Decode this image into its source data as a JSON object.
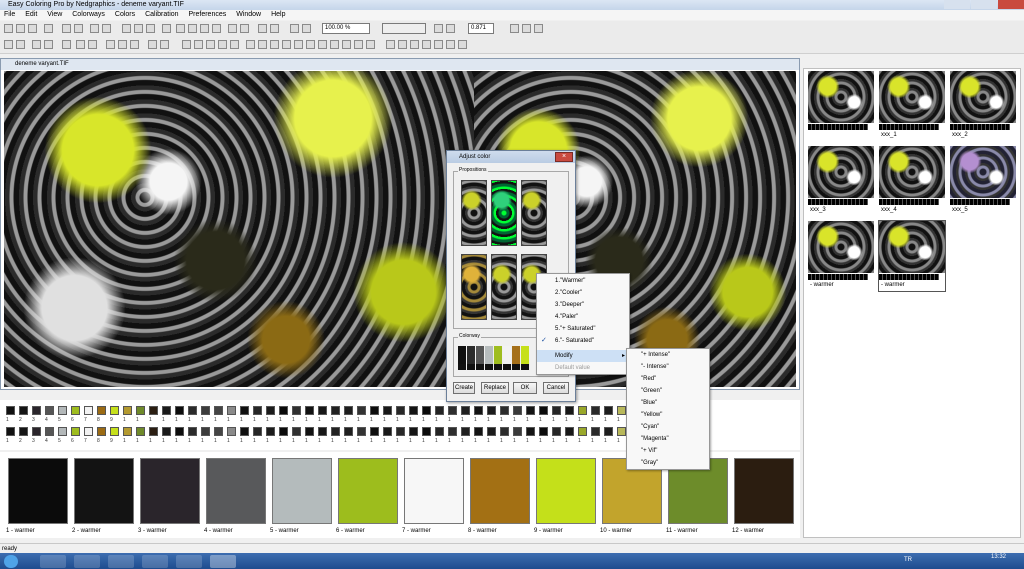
{
  "window": {
    "title": "Easy Coloring Pro by Nedgraphics - deneme varyant.TIF"
  },
  "menu": [
    "File",
    "Edit",
    "View",
    "Colorways",
    "Colors",
    "Calibration",
    "Preferences",
    "Window",
    "Help"
  ],
  "toolbar": {
    "zoom": "100.00 %",
    "value_field": "0.871"
  },
  "document": {
    "title": "deneme varyant.TIF"
  },
  "thumbnails": [
    {
      "label": ""
    },
    {
      "label": "xxx_1"
    },
    {
      "label": "xxx_2"
    },
    {
      "label": "xxx_3"
    },
    {
      "label": "xxx_4"
    },
    {
      "label": "xxx_5"
    },
    {
      "label": "- warmer"
    },
    {
      "label": "- warmer"
    }
  ],
  "swatch_strip": {
    "colors": [
      "#111111",
      "#151515",
      "#2a252b",
      "#555555",
      "#b3b8b9",
      "#9fbd1f",
      "#f2f2f2",
      "#9b6b14",
      "#c6e01c",
      "#b49a30",
      "#6f8a2a",
      "#2b1e12",
      "#1a1a1a",
      "#0d0d0d",
      "#2b2b2b",
      "#3c3c3c",
      "#444444",
      "#8a8a8a",
      "#101010",
      "#262626",
      "#1c1c1c",
      "#0a0a0a",
      "#303030",
      "#121212",
      "#171717",
      "#222222",
      "#1e1e1e",
      "#333333",
      "#0e0e0e",
      "#191919",
      "#282828",
      "#151515",
      "#0b0b0b",
      "#242424",
      "#2e2e2e",
      "#202020",
      "#131313",
      "#1b1b1b",
      "#2c2c2c",
      "#3a3a3a",
      "#141414",
      "#0c0c0c",
      "#262626",
      "#181818",
      "#9aa82a",
      "#2a2a2a",
      "#1d1d1d",
      "#b8b85a",
      "#c8c89a",
      "#d6d6b0",
      "#e5e5cc",
      "#eeeeee",
      "#cccccc",
      "#bbbbbb"
    ],
    "labels": [
      "1",
      "2",
      "3",
      "4",
      "5",
      "6",
      "7",
      "8",
      "9",
      "1",
      "1",
      "1",
      "1",
      "1",
      "1",
      "1",
      "1",
      "1",
      "1",
      "1",
      "1",
      "1",
      "1",
      "1",
      "1",
      "1",
      "1",
      "1",
      "1",
      "1",
      "1",
      "1",
      "1",
      "1",
      "1",
      "1",
      "1",
      "1",
      "1",
      "1",
      "1",
      "1",
      "1",
      "1",
      "1",
      "1",
      "1",
      "1",
      "1",
      "1",
      "1",
      "1",
      "1",
      "1"
    ]
  },
  "colorway_labels": [
    "1 - warmer",
    "2 - warmer",
    "3 - warmer",
    "4 - warmer",
    "5 - warmer",
    "6 - warmer",
    "7 - warmer",
    "8 - warmer",
    "9 - warmer",
    "10 - warmer",
    "11 - warmer",
    "12 - warmer"
  ],
  "colorway_colors": [
    "#0b0b0b",
    "#131313",
    "#2a252b",
    "#58595b",
    "#b4bbbc",
    "#9dbd1d",
    "#f7f7f7",
    "#a37014",
    "#c4e01a",
    "#c2a42c",
    "#6d8c2a",
    "#2b1d10"
  ],
  "dialog": {
    "title": "Adjust color",
    "group_propositions": "Propositions",
    "group_colorway": "Colorway",
    "buttons": {
      "create": "Create",
      "replace": "Replace",
      "ok": "OK",
      "cancel": "Cancel"
    },
    "colorway_colors": [
      "#0f0f0f",
      "#2b2b2b",
      "#555555",
      "#b6bcbd",
      "#9fbd1f",
      "#f2f2f2",
      "#a5701a",
      "#c6e01a"
    ]
  },
  "context_menu": {
    "items": [
      "1.\"Warmer\"",
      "2.\"Cooler\"",
      "3.\"Deeper\"",
      "4.\"Paler\"",
      "5.\"+ Saturated\"",
      "6.\"- Saturated\""
    ],
    "checked_index": 5,
    "modify": "Modify",
    "default": "Default value"
  },
  "submenu": {
    "items": [
      "\"+ Intense\"",
      "\"- Intense\"",
      "\"Red\"",
      "\"Green\"",
      "\"Blue\"",
      "\"Yellow\"",
      "\"Cyan\"",
      "\"Magenta\"",
      "\"+ Vif\"",
      "\"Gray\""
    ]
  },
  "status": {
    "text": "ready"
  },
  "taskbar": {
    "lang": "TR",
    "time": "13:32"
  }
}
